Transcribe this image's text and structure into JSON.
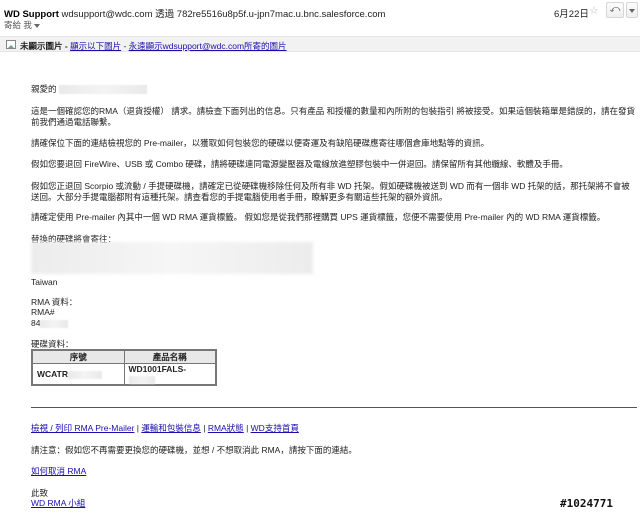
{
  "header": {
    "sender_name": "WD Support",
    "sender_email": "wdsupport@wdc.com",
    "via_label": "透過",
    "via_address": "782re5516u8p5f.u-jpn7mac.u.bnc.salesforce.com",
    "to_label": "寄給 我",
    "date": "6月22日",
    "star_icon": "☆",
    "reply_icon": "⤺"
  },
  "image_bar": {
    "label": "未顯示圖片 -",
    "show_images": "顯示以下圖片",
    "separator": " - ",
    "always_show": "永遠顯示wdsupport@wdc.com所寄的圖片"
  },
  "email": {
    "greeting": "親愛的",
    "para1": "這是一個確認您的RMA（退貨授權） 請求。請檢查下面列出的信息。只有產品 和授權的數量和內所附的包裝指引 將被接受。如果這個裝箱單是錯誤的，請在發貨前我們通過電話聯繫。",
    "para2": "請確保位下面的連結檢視您的 Pre-mailer，以獲取如何包裝您的硬碟以便寄運及有缺陷硬碟應寄往哪個倉庫地點等的資訊。",
    "para3": "假如您要退回 FireWire、USB 或 Combo 硬碟，請將硬碟連同電源變壓器及電線放進塑膠包裝中一併退回。請保留所有其他纜線、軟體及手冊。",
    "para4a": "假如您正退回 Scorpio 或流動 / 手提硬碟機，請確定已從硬碟機移除任何及所有非 WD 托架。假如硬碟機被送到 WD 而有一個非 WD 托架的話，那托架將不會被送回。大部分手提電腦都附有這種托架。請查看您的手提電腦使用者手冊，瞭解更多有關這些托架的額外資訊。",
    "para5": "請確定使用 Pre-mailer 內其中一個 WD RMA 運貨標籤。 假如您是從我們那裡購買 UPS 運貨標籤，您便不需要使用 Pre-mailer 內的 WD RMA 運貨標籤。",
    "ship_to_label": "替換的硬碟將會寄往：",
    "country": "Taiwan",
    "rma_info_label": "RMA 資料：",
    "rma_hash": "RMA#",
    "rma_number": "84",
    "hw_info_label": "硬碟資料：",
    "table_headers": [
      "序號",
      "產品名稱"
    ],
    "table_rows": [
      [
        "WCATR",
        "WD1001FALS-"
      ]
    ],
    "links": {
      "view_print": "檢視 / 列印 RMA Pre-Mailer",
      "sep1": " | ",
      "shipping": "運輸和包裝信息",
      "sep2": " | ",
      "rma_status": "RMA狀態",
      "sep3": " | ",
      "wd_support": "WD支持首頁"
    },
    "note": "請注意：假如您不再需要更換您的硬碟機，並想 / 不想取消此 RMA，請按下面的連結。",
    "cancel_link": "如何取消 RMA",
    "closing": "此致",
    "signature": "WD RMA 小組"
  },
  "watermark": "#1024771"
}
